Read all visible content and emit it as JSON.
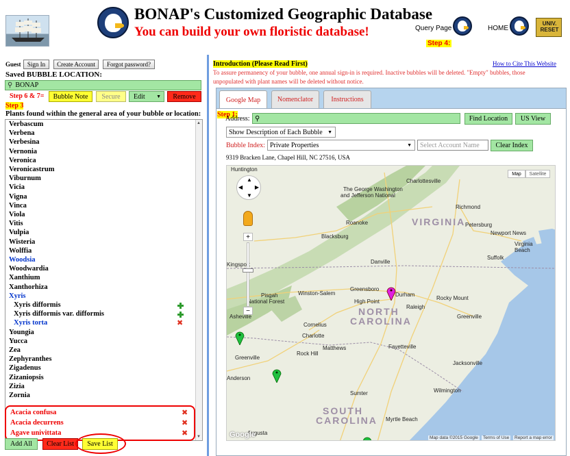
{
  "header": {
    "title": "BONAP's Customized Geographic Database",
    "subtitle": "You can build your own floristic database!",
    "query_page": "Query Page",
    "home": "HOME",
    "step4": "Step 4:",
    "reset_line1": "UNIV.",
    "reset_line2": "RESET"
  },
  "auth": {
    "guest": "Guest",
    "sign_in": "Sign In",
    "create_account": "Create Account",
    "forgot_password": "Forgot password?"
  },
  "bubble": {
    "saved_label": "Saved BUBBLE LOCATION:",
    "value": "BONAP",
    "step67": "Step 6 & 7=",
    "bubble_note": "Bubble Note",
    "secure": "Secure",
    "edit": "Edit",
    "remove": "Remove",
    "step3": "Step 3",
    "plants_label": "Plants found within the general area of your bubble or location:"
  },
  "plant_list": [
    {
      "name": "Verbascum",
      "style": "normal"
    },
    {
      "name": "Verbena",
      "style": "normal"
    },
    {
      "name": "Verbesina",
      "style": "normal"
    },
    {
      "name": "Vernonia",
      "style": "normal"
    },
    {
      "name": "Veronica",
      "style": "normal"
    },
    {
      "name": "Veronicastrum",
      "style": "normal"
    },
    {
      "name": "Viburnum",
      "style": "normal"
    },
    {
      "name": "Vicia",
      "style": "normal"
    },
    {
      "name": "Vigna",
      "style": "normal"
    },
    {
      "name": "Vinca",
      "style": "normal"
    },
    {
      "name": "Viola",
      "style": "normal"
    },
    {
      "name": "Vitis",
      "style": "normal"
    },
    {
      "name": "Vulpia",
      "style": "normal"
    },
    {
      "name": "Wisteria",
      "style": "normal"
    },
    {
      "name": "Wolffia",
      "style": "normal"
    },
    {
      "name": "Woodsia",
      "style": "blue"
    },
    {
      "name": "Woodwardia",
      "style": "normal"
    },
    {
      "name": "Xanthium",
      "style": "normal"
    },
    {
      "name": "Xanthorhiza",
      "style": "normal"
    },
    {
      "name": "Xyris",
      "style": "blue"
    },
    {
      "name": "Xyris difformis",
      "style": "indent",
      "action": "add"
    },
    {
      "name": "Xyris difformis var. difformis",
      "style": "indent",
      "action": "add"
    },
    {
      "name": "Xyris torta",
      "style": "indent-blue",
      "action": "remove"
    },
    {
      "name": "Youngia",
      "style": "normal"
    },
    {
      "name": "Yucca",
      "style": "normal"
    },
    {
      "name": "Zea",
      "style": "normal"
    },
    {
      "name": "Zephyranthes",
      "style": "normal"
    },
    {
      "name": "Zigadenus",
      "style": "normal"
    },
    {
      "name": "Zizaniopsis",
      "style": "normal"
    },
    {
      "name": "Zizia",
      "style": "normal"
    },
    {
      "name": "Zornia",
      "style": "normal"
    }
  ],
  "saved_list": [
    "Acacia confusa",
    "Acacia decurrens",
    "Agave univittata"
  ],
  "list_buttons": {
    "add_all": "Add All",
    "clear_list": "Clear List",
    "save_list": "Save List"
  },
  "intro": {
    "title": "Introduction (Please Read First)",
    "cite": "How to Cite This Website",
    "note": "To assure permanency of your bubble, one annual sign-in is required. Inactive bubbles will be deleted. \"Empty\" bubbles, those unpopulated with plant names will be deleted without notice."
  },
  "tabs": [
    "Google Map",
    "Nomenclator",
    "Instructions"
  ],
  "form": {
    "step1": "Step 1:",
    "address_label": "Address:",
    "address_value": "",
    "find_location": "Find Location",
    "us_view": "US View",
    "show_description": "Show Description of Each Bubble",
    "bubble_index_label": "Bubble Index:",
    "bubble_index_value": "Private Properties",
    "account_placeholder": "Select Account Name",
    "clear_index": "Clear Index",
    "address_text": "9319 Bracken Lane, Chapel Hill, NC 27516, USA"
  },
  "map": {
    "map_btn": "Map",
    "satellite_btn": "Satellite",
    "states": [
      "VIRGINIA",
      "NORTH",
      "CAROLINA",
      "SOUTH",
      "CAROLINA"
    ],
    "cities": [
      "Huntington",
      "Charlottesville",
      "The George Washington",
      "and Jefferson National",
      "Richmond",
      "Petersburg",
      "Roanoke",
      "Blacksburg",
      "Newport News",
      "Virginia",
      "Beach",
      "Suffolk",
      "Danville",
      "Kingsport",
      "Winston-Salem",
      "Greensboro",
      "Durham",
      "High Point",
      "Pisgah",
      "National Forest",
      "Rocky Mount",
      "Raleigh",
      "Greenville",
      "Asheville",
      "Charlotte",
      "Fayetteville",
      "Rock Hill",
      "Greenville",
      "Jacksonville",
      "Wilmington",
      "Myrtle Beach",
      "Augusta",
      "Anderson",
      "Matthews",
      "Cornelius",
      "Sumter"
    ],
    "google": "Google",
    "credits": [
      "Map data ©2015 Google",
      "Terms of Use",
      "Report a map error"
    ],
    "colors": {
      "water": "#a6c7e8",
      "land": "#eceee2",
      "mountain": "#b8d2a0",
      "pin_magenta": "#e020e0",
      "pin_green": "#20c040"
    }
  }
}
